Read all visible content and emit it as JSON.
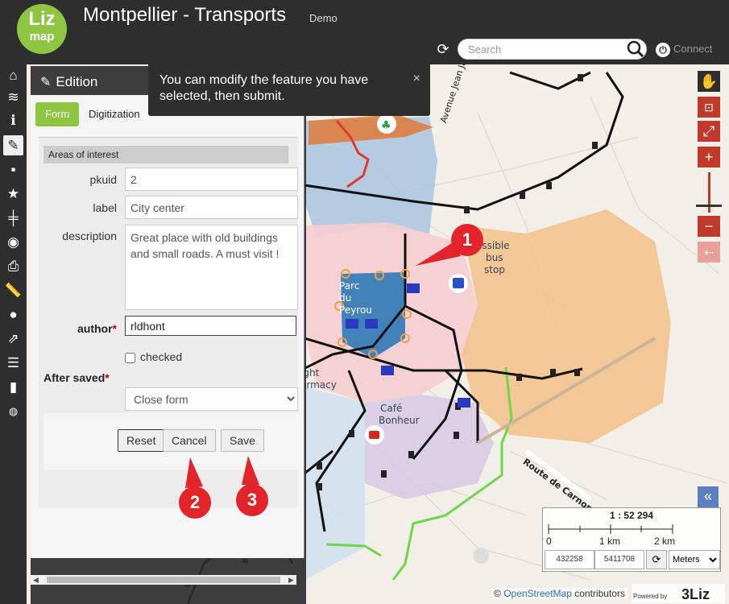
{
  "header": {
    "logo_line1": "Liz",
    "logo_line2": "map",
    "title": "Montpellier - Transports",
    "subtitle": "Demo",
    "search_placeholder": "Search",
    "connect_label": "Connect"
  },
  "sidebar": {
    "icons": [
      "home-icon",
      "layers-icon",
      "info-icon",
      "edition-icon",
      "comment-icon",
      "star-icon",
      "signpost-icon",
      "locate-icon",
      "print-icon",
      "measure-icon",
      "chat-icon",
      "share-icon",
      "list-icon",
      "chart-icon",
      "globe-icon"
    ]
  },
  "dock": {
    "title": "Edition",
    "tabs": {
      "form": "Form",
      "digitization": "Digitization"
    },
    "group_title": "Areas of interest",
    "fields": {
      "pkuid_label": "pkuid",
      "pkuid_value": "2",
      "label_label": "label",
      "label_value": "City center",
      "description_label": "description",
      "description_value": "Great place with old buildings and small roads. A must visit !",
      "author_label": "author",
      "author_value": "rldhont",
      "checked_label": "checked",
      "after_saved_label": "After saved",
      "after_saved_value": "Close form",
      "required_mark": "*"
    },
    "buttons": {
      "reset": "Reset",
      "cancel": "Cancel",
      "save": "Save"
    }
  },
  "tooltip": {
    "message": "You can modify the feature you have selected, then submit.",
    "close": "×"
  },
  "markers": {
    "m1": "1",
    "m2": "2",
    "m3": "3"
  },
  "map_labels": {
    "avenue": "Avenue Jean Jaurès",
    "accessible_l1": "essible",
    "accessible_l2": "bus",
    "accessible_l3": "stop",
    "parc_l1": "Parc",
    "parc_l2": "du",
    "parc_l3": "Peyrou",
    "night_l1": "ight",
    "night_l2": "armacy",
    "cafe_l1": "Café",
    "cafe_l2": "Bonheur",
    "route": "Route de Carnon"
  },
  "scale": {
    "ratio": "1 : 52 294",
    "tick0": "0",
    "tick1": "1 km",
    "tick2": "2 km",
    "x": "432258",
    "y": "5411708",
    "units": "Meters"
  },
  "attribution": {
    "prefix": "©",
    "link": "OpenStreetMap",
    "suffix": "contributors"
  },
  "powered": {
    "by": "Powered by",
    "brand": "3Liz"
  },
  "colors": {
    "accent": "#8ec641",
    "marker": "#e3242b",
    "dark": "#2e2e2e",
    "tool_red": "#c0392b"
  }
}
